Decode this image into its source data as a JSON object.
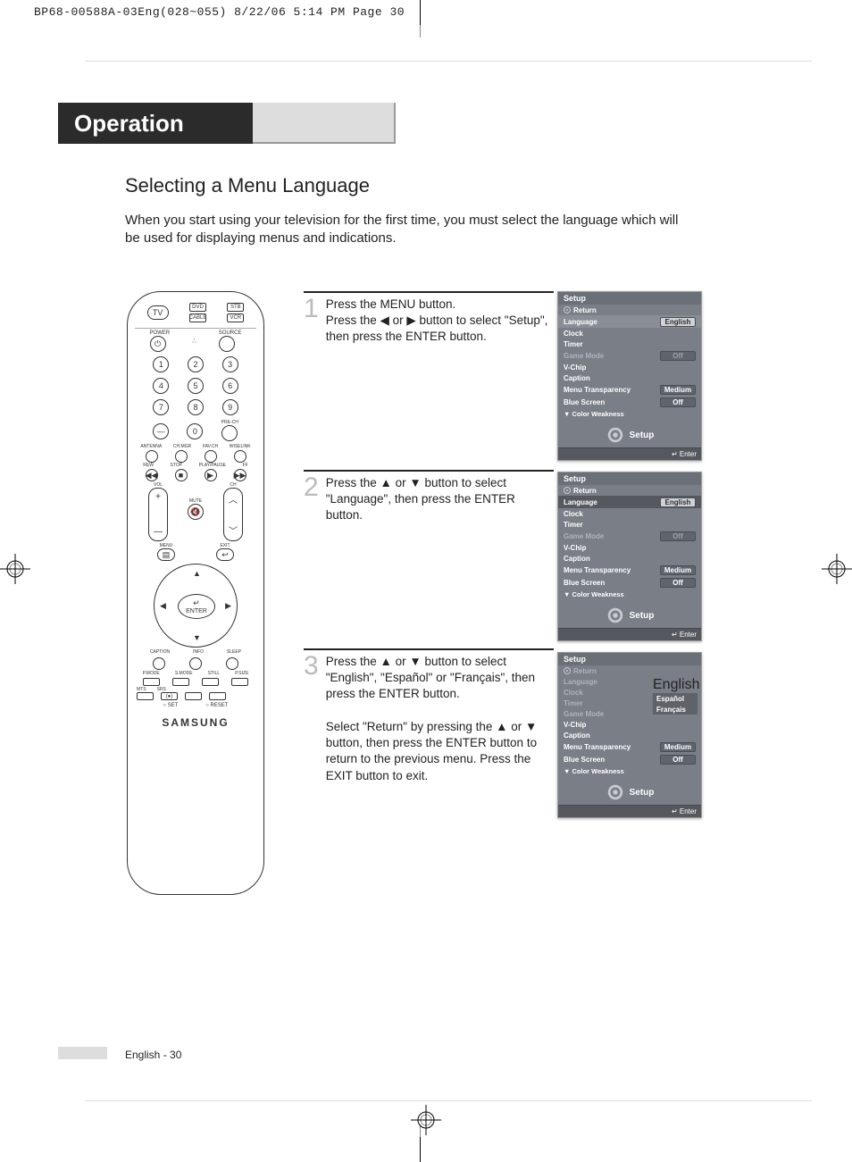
{
  "print_header": "BP68-00588A-03Eng(028~055)  8/22/06  5:14 PM  Page 30",
  "title": "Operation",
  "subtitle": "Selecting a Menu Language",
  "intro": "When you start using your television for the first time, you must select the language which will be used for displaying menus and indications.",
  "steps": [
    {
      "num": "1",
      "text": "Press the MENU button.\nPress the ◀ or ▶ button to select \"Setup\", then press the ENTER button."
    },
    {
      "num": "2",
      "text": "Press the ▲ or ▼ button to select \"Language\", then press the ENTER button."
    },
    {
      "num": "3",
      "text": "Press the ▲ or ▼ button to select \"English\", \"Español\" or \"Français\", then press the ENTER button.\n\nSelect \"Return\" by pressing the ▲ or ▼ button, then press the ENTER button to return to the previous menu. Press the EXIT button to exit."
    }
  ],
  "remote": {
    "top_modes": {
      "tv": "TV",
      "dvd": "DVD",
      "stb": "STB",
      "cable": "CABLE",
      "vcr": "VCR"
    },
    "power": "POWER",
    "source": "SOURCE",
    "keypad": [
      "1",
      "2",
      "3",
      "4",
      "5",
      "6",
      "7",
      "8",
      "9",
      "0"
    ],
    "dash": "—",
    "plus": "+",
    "prech": "PRE-CH",
    "row_lbls": [
      "ANTENNA",
      "CH.MGR",
      "FAV.CH",
      "WISELINK"
    ],
    "transport_lbls": [
      "REW",
      "STOP",
      "PLAY/PAUSE",
      "FF"
    ],
    "vol": "VOL",
    "ch": "CH",
    "mute": "MUTE",
    "menu": "MENU",
    "exit": "EXIT",
    "enter": "ENTER",
    "bot_lbls": [
      "CAPTION",
      "INFO",
      "SLEEP"
    ],
    "bot2_lbls": [
      "P.MODE",
      "S.MODE",
      "STILL",
      "P.SIZE"
    ],
    "bot3_lbls": [
      "MTS",
      "SRS"
    ],
    "setreset": {
      "set": "SET",
      "reset": "RESET"
    },
    "brand": "SAMSUNG"
  },
  "menu_common": {
    "title": "Setup",
    "return": "Return",
    "rows": {
      "language": "Language",
      "clock": "Clock",
      "timer": "Timer",
      "game": "Game Mode",
      "vchip": "V-Chip",
      "caption": "Caption",
      "transp": "Menu Transparency",
      "blue": "Blue Screen",
      "color": "Color Weakness"
    },
    "vals": {
      "english": "English",
      "off": "Off",
      "medium": "Medium"
    },
    "foot_label": "Setup",
    "enter": "Enter"
  },
  "menu3_langs": [
    "English",
    "Español",
    "Français"
  ],
  "page_footer": "English - 30"
}
